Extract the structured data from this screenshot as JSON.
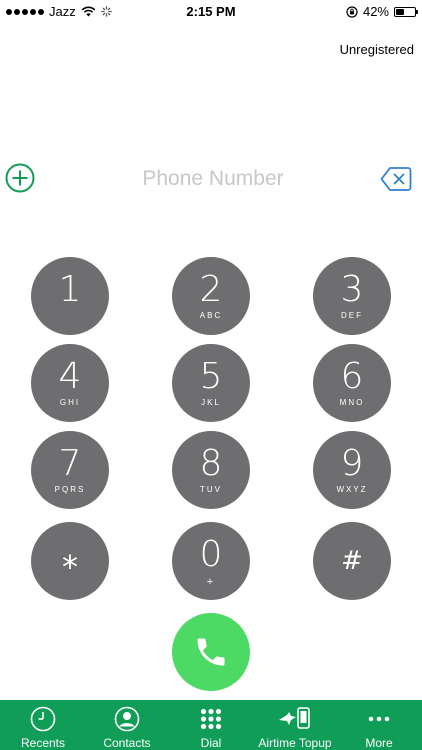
{
  "status_bar": {
    "carrier": "Jazz",
    "time": "2:15 PM",
    "battery_percent": "42%",
    "battery_level": 0.42
  },
  "registration_status": "Unregistered",
  "dialer": {
    "placeholder": "Phone Number",
    "value": ""
  },
  "keypad": [
    {
      "digit": "1",
      "letters": ""
    },
    {
      "digit": "2",
      "letters": "ABC"
    },
    {
      "digit": "3",
      "letters": "DEF"
    },
    {
      "digit": "4",
      "letters": "GHI"
    },
    {
      "digit": "5",
      "letters": "JKL"
    },
    {
      "digit": "6",
      "letters": "MNO"
    },
    {
      "digit": "7",
      "letters": "PQRS"
    },
    {
      "digit": "8",
      "letters": "TUV"
    },
    {
      "digit": "9",
      "letters": "WXYZ"
    },
    {
      "digit": "*",
      "letters": ""
    },
    {
      "digit": "0",
      "letters": "+"
    },
    {
      "digit": "#",
      "letters": ""
    }
  ],
  "tabs": [
    {
      "label": "Recents",
      "icon": "clock-icon"
    },
    {
      "label": "Contacts",
      "icon": "person-icon"
    },
    {
      "label": "Dial",
      "icon": "keypad-icon"
    },
    {
      "label": "Airtime Topup",
      "icon": "airtime-topup-icon"
    },
    {
      "label": "More",
      "icon": "more-icon"
    }
  ],
  "colors": {
    "accent_green": "#109d57",
    "call_green": "#4cd964",
    "key_gray": "#6e6e70",
    "backspace_blue": "#2f80d1"
  }
}
